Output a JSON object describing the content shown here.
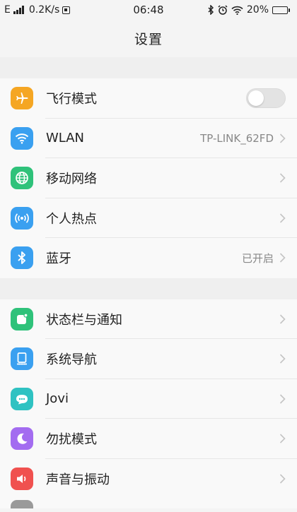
{
  "status_bar": {
    "network_type": "E",
    "speed": "0.2K/s",
    "time": "06:48",
    "battery": "20%",
    "battery_level": 20
  },
  "header": {
    "title": "设置"
  },
  "groups": [
    {
      "items": [
        {
          "label": "飞行模式",
          "icon": "airplane-icon",
          "color": "#f5a623",
          "toggle": false
        },
        {
          "label": "WLAN",
          "icon": "wifi-icon",
          "color": "#3aa0f0",
          "value": "TP-LINK_62FD"
        },
        {
          "label": "移动网络",
          "icon": "globe-icon",
          "color": "#2fc27a"
        },
        {
          "label": "个人热点",
          "icon": "hotspot-icon",
          "color": "#3aa0f0"
        },
        {
          "label": "蓝牙",
          "icon": "bluetooth-icon",
          "color": "#3aa0f0",
          "value": "已开启"
        }
      ]
    },
    {
      "items": [
        {
          "label": "状态栏与通知",
          "icon": "notification-icon",
          "color": "#2fc27a"
        },
        {
          "label": "系统导航",
          "icon": "navigation-icon",
          "color": "#3aa0f0"
        },
        {
          "label": "Jovi",
          "icon": "jovi-icon",
          "color": "#2fc2c2"
        },
        {
          "label": "勿扰模式",
          "icon": "moon-icon",
          "color": "#a36cf0"
        },
        {
          "label": "声音与振动",
          "icon": "speaker-icon",
          "color": "#f0514f"
        }
      ]
    }
  ]
}
